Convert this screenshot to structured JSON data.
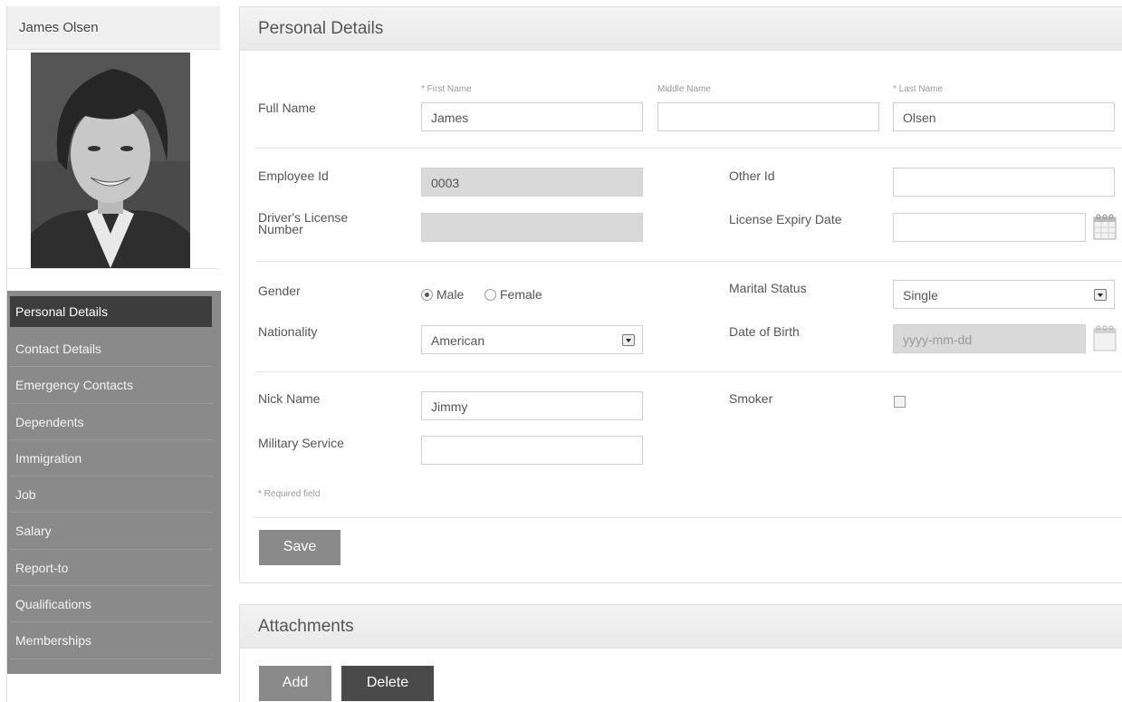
{
  "profile": {
    "name": "James Olsen"
  },
  "nav": {
    "items": [
      {
        "label": "Personal Details",
        "active": true
      },
      {
        "label": "Contact Details"
      },
      {
        "label": "Emergency Contacts"
      },
      {
        "label": "Dependents"
      },
      {
        "label": "Immigration"
      },
      {
        "label": "Job"
      },
      {
        "label": "Salary"
      },
      {
        "label": "Report-to"
      },
      {
        "label": "Qualifications"
      },
      {
        "label": "Memberships"
      }
    ]
  },
  "personal": {
    "title": "Personal Details",
    "full_name_label": "Full Name",
    "first_name_label": "* First Name",
    "middle_name_label": "Middle Name",
    "last_name_label": "* Last Name",
    "first_name": "James",
    "middle_name": "",
    "last_name": "Olsen",
    "employee_id_label": "Employee Id",
    "employee_id": "0003",
    "other_id_label": "Other Id",
    "other_id": "",
    "license_label": "Driver's License Number",
    "license_line1": "Driver's License",
    "license_line2": "Number",
    "license_value": "",
    "license_expiry_label": "License Expiry Date",
    "license_expiry_value": "",
    "gender_label": "Gender",
    "gender_male": "Male",
    "gender_female": "Female",
    "gender_selected": "Male",
    "marital_label": "Marital Status",
    "marital_value": "Single",
    "nationality_label": "Nationality",
    "nationality_value": "American",
    "dob_label": "Date of Birth",
    "dob_placeholder": "yyyy-mm-dd",
    "nickname_label": "Nick Name",
    "nickname_value": "Jimmy",
    "smoker_label": "Smoker",
    "smoker_checked": false,
    "military_label": "Military Service",
    "military_value": "",
    "required_note": "* Required field",
    "save_label": "Save"
  },
  "attachments": {
    "title": "Attachments",
    "add_label": "Add",
    "delete_label": "Delete"
  },
  "colors": {
    "nav_bg": "#8a8a8a",
    "nav_active": "#3d3d3d",
    "button_grey": "#8a8a8a",
    "button_dark": "#4a4a4a",
    "readonly_bg": "#d9d9d9"
  }
}
